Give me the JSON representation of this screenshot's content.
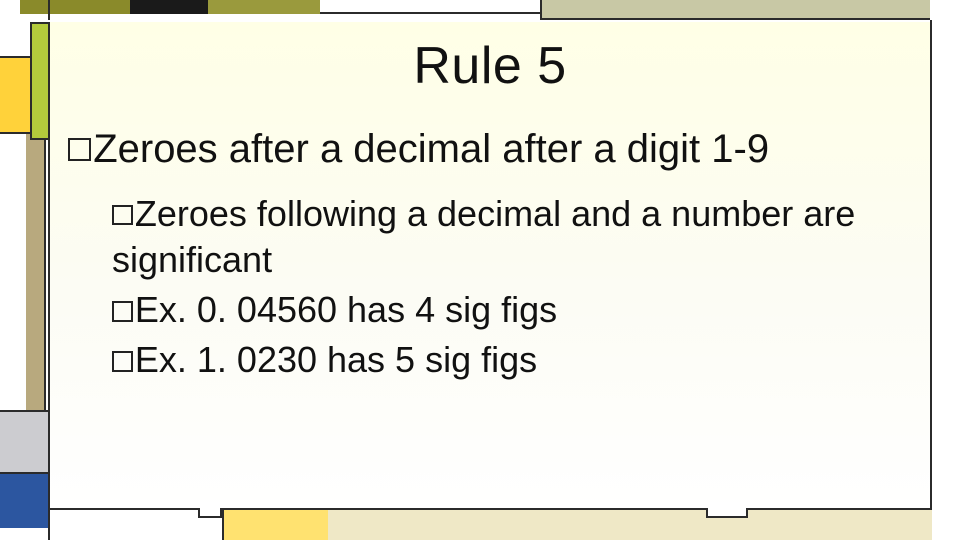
{
  "slide": {
    "title": "Rule 5",
    "bullet": "Zeroes after a decimal after a digit 1-9",
    "sub": [
      "Zeroes following a decimal and a number are significant",
      "Ex. 0. 04560 has 4 sig figs",
      "Ex. 1. 0230 has 5 sig figs"
    ]
  }
}
